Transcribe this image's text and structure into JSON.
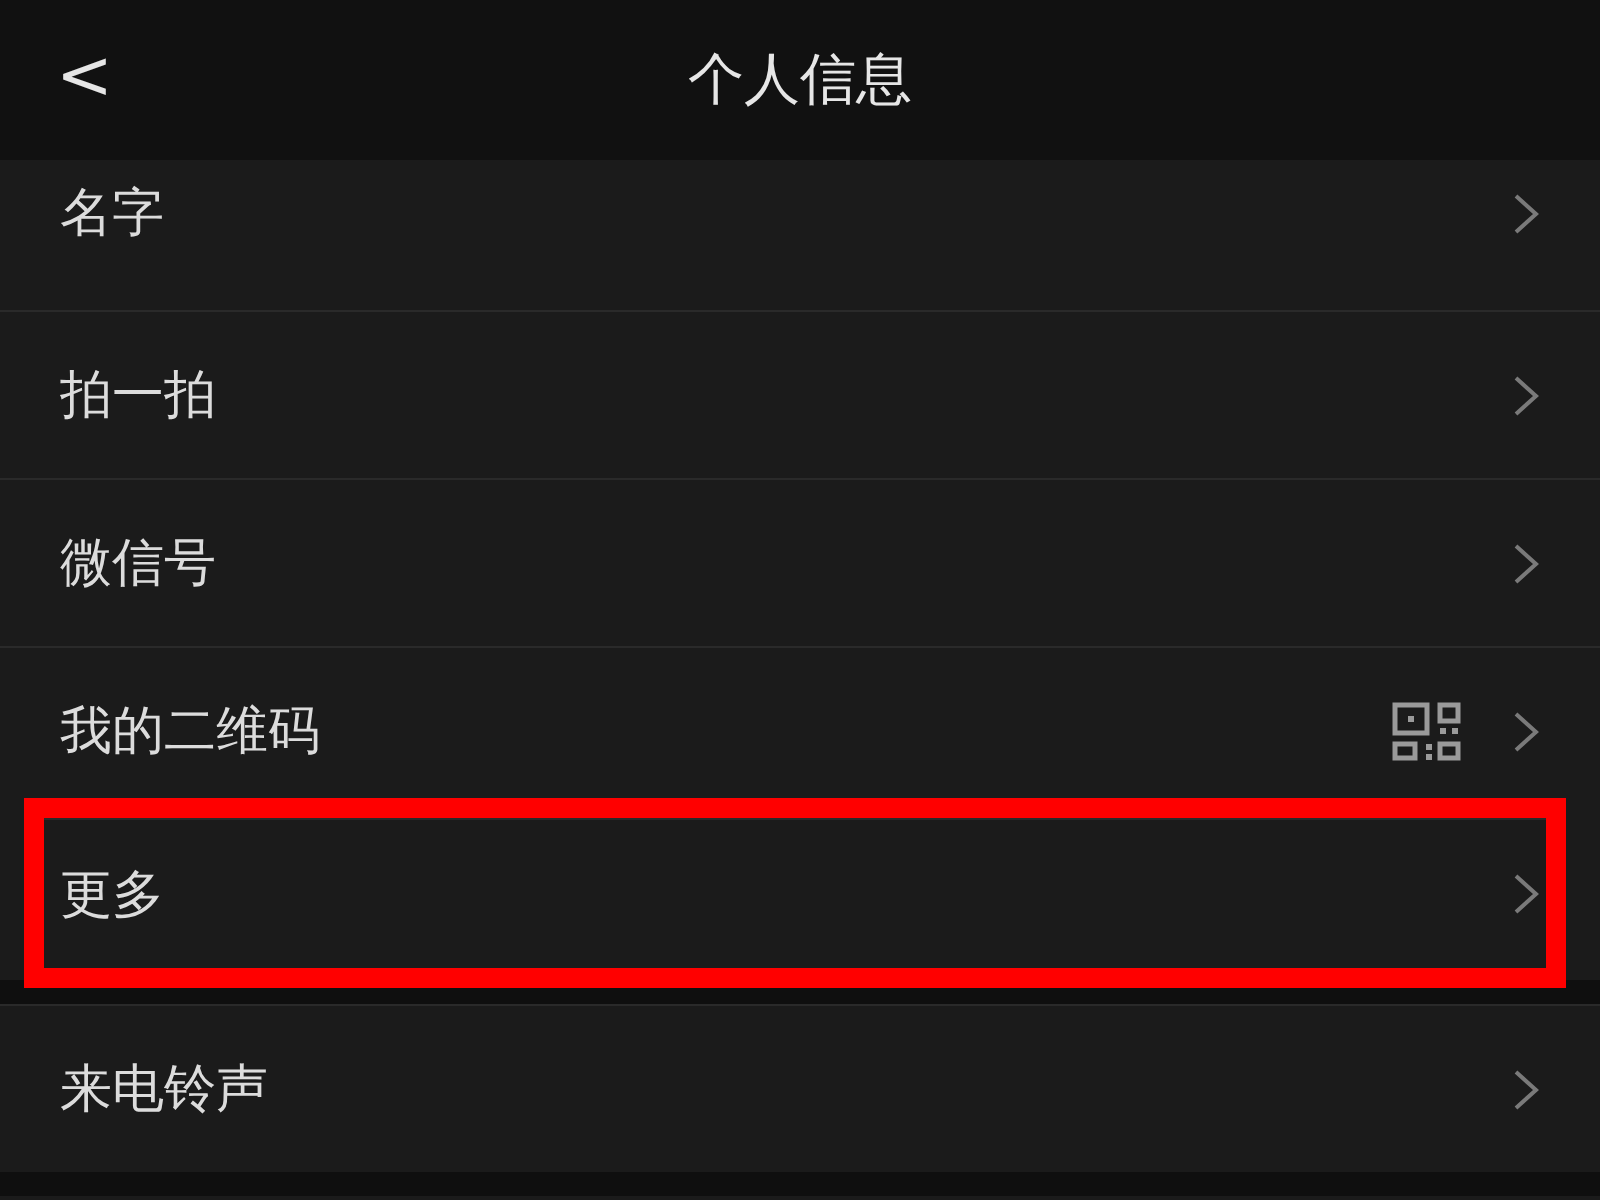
{
  "header": {
    "back": "<",
    "title": "个人信息"
  },
  "groups": [
    {
      "items": [
        {
          "label": "名字",
          "kind": "plain",
          "highlighted": false
        },
        {
          "label": "拍一拍",
          "kind": "plain",
          "highlighted": false
        },
        {
          "label": "微信号",
          "kind": "plain",
          "highlighted": false
        },
        {
          "label": "我的二维码",
          "kind": "qr",
          "highlighted": false
        },
        {
          "label": "更多",
          "kind": "plain",
          "highlighted": true
        }
      ]
    },
    {
      "items": [
        {
          "label": "来电铃声",
          "kind": "plain",
          "highlighted": false
        }
      ]
    }
  ]
}
